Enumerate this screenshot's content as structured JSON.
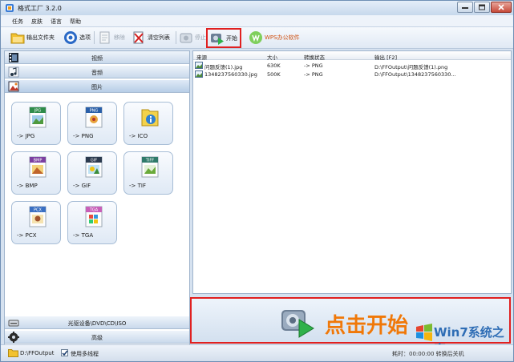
{
  "window": {
    "title": "格式工厂 3.2.0"
  },
  "menu": [
    "任务",
    "皮肤",
    "语言",
    "帮助"
  ],
  "toolbar": {
    "output_folder": "输出文件夹",
    "options": "选项",
    "remove": "移除",
    "clear_list": "清空列表",
    "stop": "停止",
    "start": "开始",
    "wps": "WPS办公软件"
  },
  "categories": {
    "video": "视频",
    "audio": "音频",
    "image": "图片",
    "rom": "光驱设备\\DVD\\CD\\ISO",
    "advanced": "高级"
  },
  "formats": [
    {
      "tag": "JPG",
      "label": "-> JPG"
    },
    {
      "tag": "PNG",
      "label": "-> PNG"
    },
    {
      "tag": "ICO",
      "label": "-> ICO"
    },
    {
      "tag": "BMP",
      "label": "-> BMP"
    },
    {
      "tag": "GIF",
      "label": "-> GIF"
    },
    {
      "tag": "TIFF",
      "label": "-> TIF"
    },
    {
      "tag": "PCX",
      "label": "-> PCX"
    },
    {
      "tag": "TGA",
      "label": "-> TGA"
    }
  ],
  "file_list": {
    "columns": [
      "来源",
      "大小",
      "转换状态",
      "输出 [F2]"
    ],
    "rows": [
      {
        "source": "问题反馈(1).jpg",
        "size": "630K",
        "status": "-> PNG",
        "output": "D:\\FFOutput\\问题反馈(1).png"
      },
      {
        "source": "1348237560330.jpg",
        "size": "500K",
        "status": "-> PNG",
        "output": "D:\\FFOutput\\1348237560330..."
      }
    ]
  },
  "start_area": {
    "text": "点击开始"
  },
  "watermark": {
    "text": "Win7系统之家"
  },
  "status": {
    "path": "D:\\FFOutput",
    "multithread": "使用多线程",
    "right": "耗时：00:00:00 转换后关机"
  },
  "colors": {
    "accent_red": "#e02020",
    "start_orange": "#f07808",
    "panel_blue": "#c9d9ec"
  }
}
